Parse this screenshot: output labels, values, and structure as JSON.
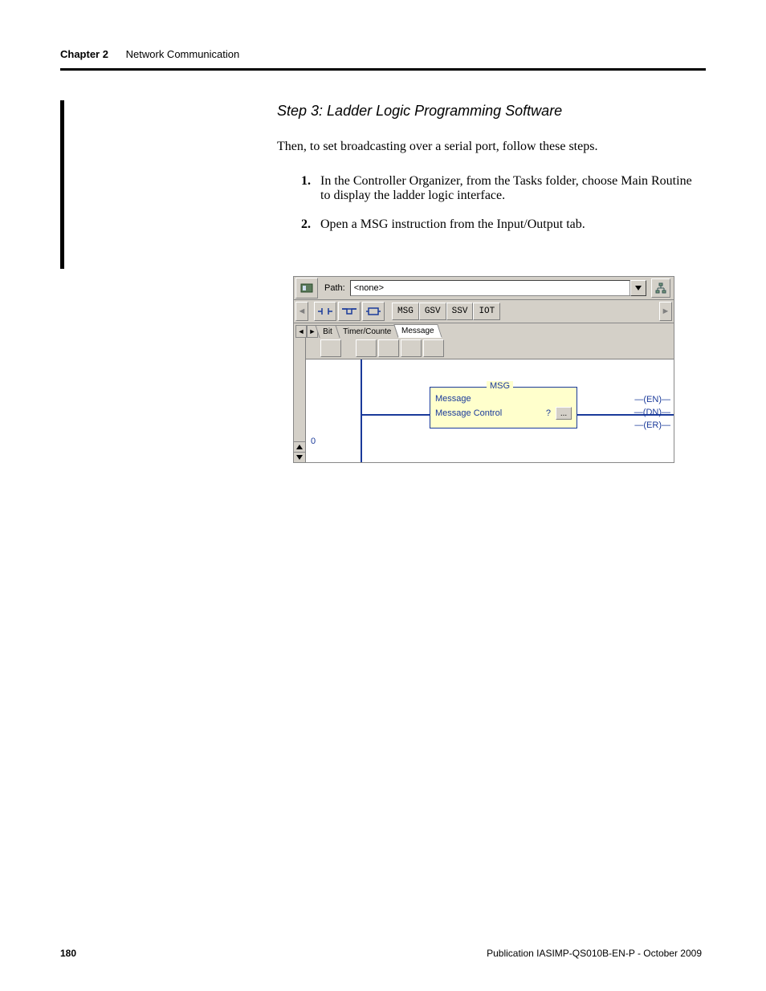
{
  "header": {
    "chapter": "Chapter 2",
    "title": "Network Communication"
  },
  "section": {
    "step_title": "Step 3: Ladder Logic Programming Software",
    "intro": "Then, to set broadcasting over a serial port, follow these steps.",
    "steps": [
      "In the Controller Organizer, from the Tasks folder, choose Main Routine to display the ladder logic interface.",
      "Open a MSG instruction from the Input/Output tab."
    ]
  },
  "figure": {
    "path_label": "Path:",
    "path_value": "<none>",
    "elem_buttons_text": [
      "MSG",
      "GSV",
      "SSV",
      "IOT"
    ],
    "tabs": {
      "prev_hidden": "Bit",
      "middle": "Timer/Counte",
      "active": "Message"
    },
    "msg_block": {
      "title": "MSG",
      "line1": "Message",
      "line2_label": "Message Control",
      "line2_value": "?",
      "dots": "..."
    },
    "coils": [
      "(EN)",
      "(DN)",
      "(ER)"
    ],
    "rung_number": "0"
  },
  "footer": {
    "page": "180",
    "pub": "Publication IASIMP-QS010B-EN-P - October 2009"
  }
}
